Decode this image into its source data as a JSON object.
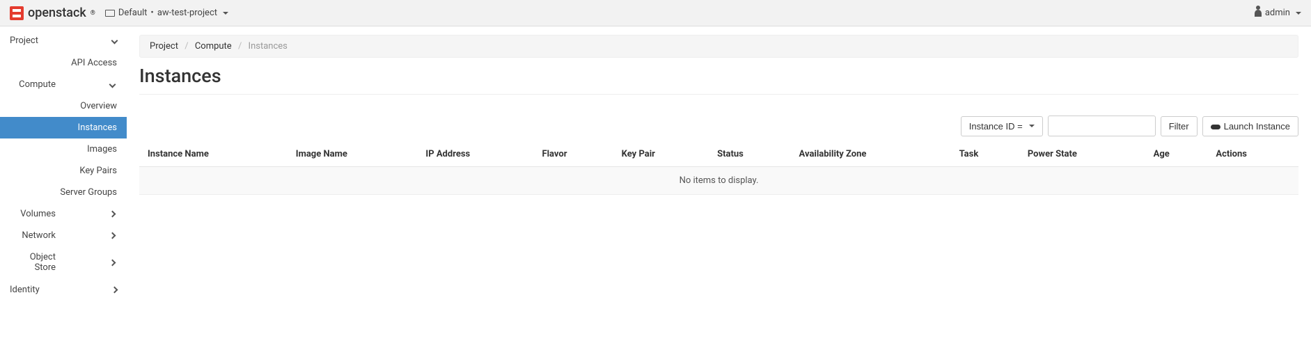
{
  "topbar": {
    "brand": "openstack",
    "domain_label": "Default",
    "project_label": "aw-test-project",
    "user_label": "admin"
  },
  "sidebar": {
    "project_label": "Project",
    "api_access_label": "API Access",
    "compute_label": "Compute",
    "compute_items": {
      "overview": "Overview",
      "instances": "Instances",
      "images": "Images",
      "key_pairs": "Key Pairs",
      "server_groups": "Server Groups"
    },
    "volumes_label": "Volumes",
    "network_label": "Network",
    "object_store_label": "Object Store",
    "identity_label": "Identity"
  },
  "breadcrumb": {
    "project": "Project",
    "compute": "Compute",
    "instances": "Instances"
  },
  "page_title": "Instances",
  "toolbar": {
    "filter_field_label": "Instance ID =",
    "filter_button": "Filter",
    "launch_button": "Launch Instance"
  },
  "table": {
    "headers": {
      "instance_name": "Instance Name",
      "image_name": "Image Name",
      "ip_address": "IP Address",
      "flavor": "Flavor",
      "key_pair": "Key Pair",
      "status": "Status",
      "availability_zone": "Availability Zone",
      "task": "Task",
      "power_state": "Power State",
      "age": "Age",
      "actions": "Actions"
    },
    "empty_message": "No items to display."
  }
}
